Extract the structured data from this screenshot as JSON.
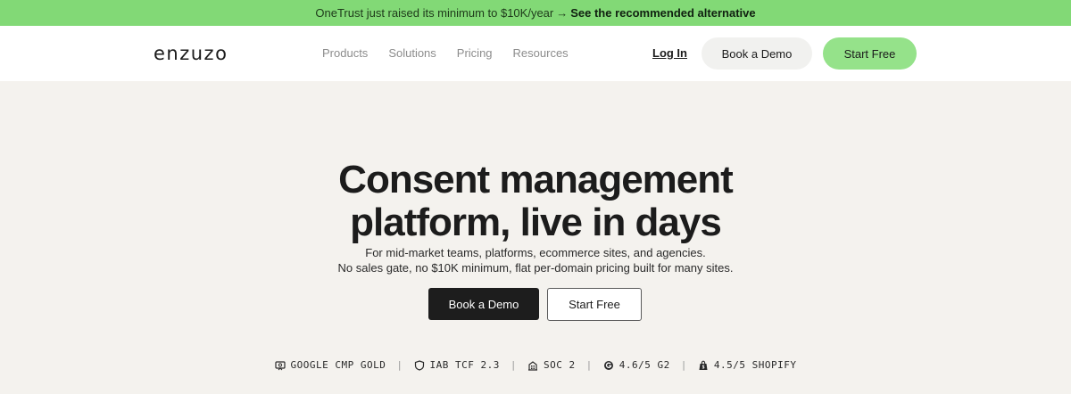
{
  "announcement": {
    "text": "OneTrust just raised its minimum to $10K/year",
    "arrow": "→",
    "link": "See the recommended alternative"
  },
  "header": {
    "logo": "enzuzo",
    "nav": [
      "Products",
      "Solutions",
      "Pricing",
      "Resources"
    ],
    "login": "Log In",
    "book_demo": "Book a Demo",
    "start_free": "Start Free"
  },
  "hero": {
    "title_line1": "Consent management",
    "title_line2": "platform, live in days",
    "sub_line1": "For mid-market teams, platforms, ecommerce sites, and agencies.",
    "sub_line2": "No sales gate, no $10K minimum, flat per-domain pricing built for many sites.",
    "book_demo": "Book a Demo",
    "start_free": "Start Free"
  },
  "badges": [
    {
      "icon": "google-cmp-icon",
      "label": "GOOGLE CMP GOLD"
    },
    {
      "icon": "shield-icon",
      "label": "IAB TCF 2.3"
    },
    {
      "icon": "building-icon",
      "label": "SOC 2"
    },
    {
      "icon": "g2-icon",
      "label": "4.6/5 G2"
    },
    {
      "icon": "shopify-icon",
      "label": "4.5/5 SHOPIFY"
    }
  ],
  "badge_separator": "|",
  "colors": {
    "announcement_bg": "#82d976",
    "page_bg": "#f4f2ee",
    "accent_green": "#95e28a",
    "dark_button": "#1d1d1d"
  }
}
